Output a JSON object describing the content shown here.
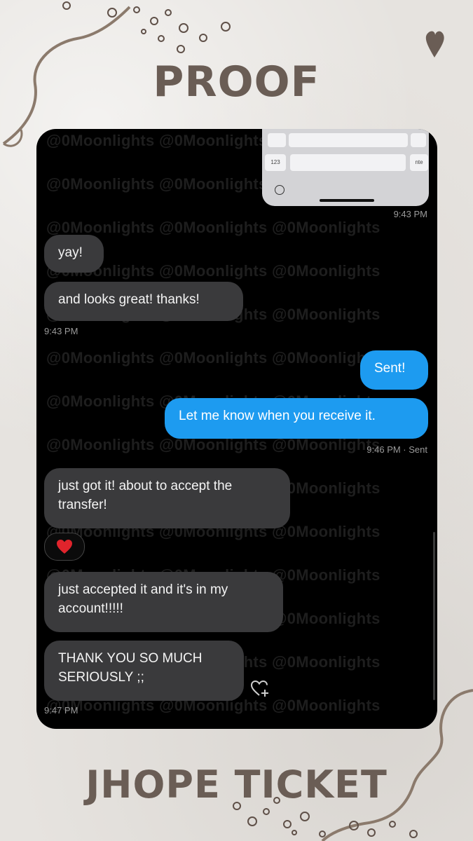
{
  "title_top": "PROOF",
  "title_bottom": "JHOPE TICKET",
  "watermark": "@0Moonlights @0Moonlights @0Moonlights",
  "keyboard": {
    "key_123": "123",
    "key_right": "nte"
  },
  "messages": [
    {
      "text": "yay!",
      "direction": "in"
    },
    {
      "text": "and looks great! thanks!",
      "direction": "in"
    },
    {
      "text": "Sent!",
      "direction": "out"
    },
    {
      "text": "Let me know when you receive it.",
      "direction": "out"
    },
    {
      "text": "just got it! about to accept the transfer!",
      "direction": "in"
    },
    {
      "text": "just accepted it and it's in my account!!!!!",
      "direction": "in"
    },
    {
      "text": "THANK YOU SO MUCH SERIOUSLY ;;",
      "direction": "in"
    }
  ],
  "timestamps": {
    "t1": "9:43 PM",
    "t2": "9:43 PM",
    "t3": "9:46 PM · Sent",
    "t4": "9:47 PM"
  },
  "reaction_emoji": "heart",
  "colors": {
    "background": "#e6e3df",
    "title": "#6a5d55",
    "deco_line": "#8b7a6c",
    "phone": "#000000",
    "incoming_bubble": "#3a3a3c",
    "outgoing_bubble": "#1d9bf0",
    "reaction_heart": "#e0242c"
  }
}
